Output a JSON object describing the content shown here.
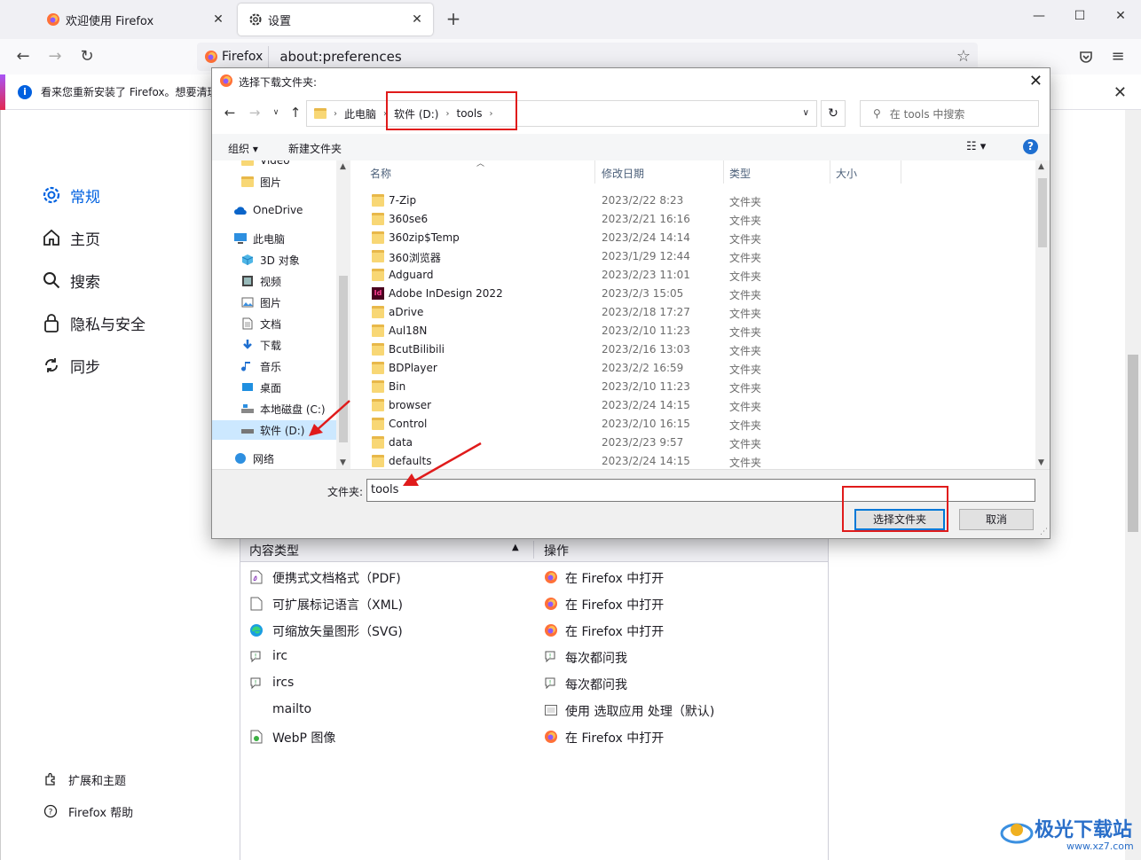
{
  "browser": {
    "tabs": [
      {
        "title": "欢迎使用 Firefox",
        "active": false
      },
      {
        "title": "设置",
        "active": true
      }
    ],
    "url_identity": "Firefox",
    "url": "about:preferences",
    "notice_text": "看来您重新安装了 Firefox。想要清理"
  },
  "prefs_nav": {
    "items": [
      "常规",
      "主页",
      "搜索",
      "隐私与安全",
      "同步"
    ],
    "footer": [
      "扩展和主题",
      "Firefox 帮助"
    ]
  },
  "content_table": {
    "header_type": "内容类型",
    "header_action": "操作",
    "rows": [
      {
        "type": "便携式文档格式（PDF)",
        "action": "在 Firefox 中打开",
        "type_icon": "pdf-icon",
        "action_icon": "firefox-icon"
      },
      {
        "type": "可扩展标记语言（XML)",
        "action": "在 Firefox 中打开",
        "type_icon": "file-icon",
        "action_icon": "firefox-icon"
      },
      {
        "type": "可缩放矢量图形（SVG)",
        "action": "在 Firefox 中打开",
        "type_icon": "edge-icon",
        "action_icon": "firefox-icon"
      },
      {
        "type": "irc",
        "action": "每次都问我",
        "type_icon": "ask-icon",
        "action_icon": "ask-icon"
      },
      {
        "type": "ircs",
        "action": "每次都问我",
        "type_icon": "ask-icon",
        "action_icon": "ask-icon"
      },
      {
        "type": "mailto",
        "action": "使用 选取应用 处理（默认)",
        "type_icon": "",
        "action_icon": "app-icon"
      },
      {
        "type": "WebP 图像",
        "action": "在 Firefox 中打开",
        "type_icon": "image-file-icon",
        "action_icon": "firefox-icon"
      }
    ]
  },
  "dialog": {
    "title": "选择下载文件夹:",
    "breadcrumb": [
      "此电脑",
      "软件 (D:)",
      "tools"
    ],
    "search_placeholder": "在 tools 中搜索",
    "toolbar": {
      "organize": "组织 ▾",
      "new_folder": "新建文件夹"
    },
    "tree": [
      {
        "label": "Video",
        "icon": "folder-icon",
        "indent": 1
      },
      {
        "label": "图片",
        "icon": "folder-icon",
        "indent": 1
      },
      {
        "label": "OneDrive",
        "icon": "cloud-icon",
        "indent": 0
      },
      {
        "label": "此电脑",
        "icon": "computer-icon",
        "indent": 0
      },
      {
        "label": "3D 对象",
        "icon": "cube-icon",
        "indent": 1
      },
      {
        "label": "视频",
        "icon": "video-icon",
        "indent": 1
      },
      {
        "label": "图片",
        "icon": "pictures-icon",
        "indent": 1
      },
      {
        "label": "文档",
        "icon": "document-icon",
        "indent": 1
      },
      {
        "label": "下载",
        "icon": "download-icon",
        "indent": 1
      },
      {
        "label": "音乐",
        "icon": "music-icon",
        "indent": 1
      },
      {
        "label": "桌面",
        "icon": "desktop-icon",
        "indent": 1
      },
      {
        "label": "本地磁盘 (C:)",
        "icon": "disk-icon",
        "indent": 1
      },
      {
        "label": "软件 (D:)",
        "icon": "drive-icon",
        "indent": 1,
        "selected": true
      },
      {
        "label": "网络",
        "icon": "network-icon",
        "indent": 0
      }
    ],
    "columns": [
      "名称",
      "修改日期",
      "类型",
      "大小"
    ],
    "files": [
      {
        "name": "7-Zip",
        "date": "2023/2/22 8:23",
        "type": "文件夹"
      },
      {
        "name": "360se6",
        "date": "2023/2/21 16:16",
        "type": "文件夹"
      },
      {
        "name": "360zip$Temp",
        "date": "2023/2/24 14:14",
        "type": "文件夹"
      },
      {
        "name": "360浏览器",
        "date": "2023/1/29 12:44",
        "type": "文件夹"
      },
      {
        "name": "Adguard",
        "date": "2023/2/23 11:01",
        "type": "文件夹"
      },
      {
        "name": "Adobe InDesign 2022",
        "date": "2023/2/3 15:05",
        "type": "文件夹",
        "icon": "indesign-icon"
      },
      {
        "name": "aDrive",
        "date": "2023/2/18 17:27",
        "type": "文件夹"
      },
      {
        "name": "Aul18N",
        "date": "2023/2/10 11:23",
        "type": "文件夹"
      },
      {
        "name": "BcutBilibili",
        "date": "2023/2/16 13:03",
        "type": "文件夹"
      },
      {
        "name": "BDPlayer",
        "date": "2023/2/2 16:59",
        "type": "文件夹"
      },
      {
        "name": "Bin",
        "date": "2023/2/10 11:23",
        "type": "文件夹"
      },
      {
        "name": "browser",
        "date": "2023/2/24 14:15",
        "type": "文件夹"
      },
      {
        "name": "Control",
        "date": "2023/2/10 16:15",
        "type": "文件夹"
      },
      {
        "name": "data",
        "date": "2023/2/23 9:57",
        "type": "文件夹"
      },
      {
        "name": "defaults",
        "date": "2023/2/24 14:15",
        "type": "文件夹"
      }
    ],
    "folder_label": "文件夹:",
    "folder_value": "tools",
    "select_button": "选择文件夹",
    "cancel_button": "取消"
  },
  "watermark": {
    "text": "极光下载站",
    "url": "www.xz7.com"
  },
  "colors": {
    "accent": "#0061e0",
    "annotation": "#e01b1b",
    "folder": "#f8d775"
  }
}
